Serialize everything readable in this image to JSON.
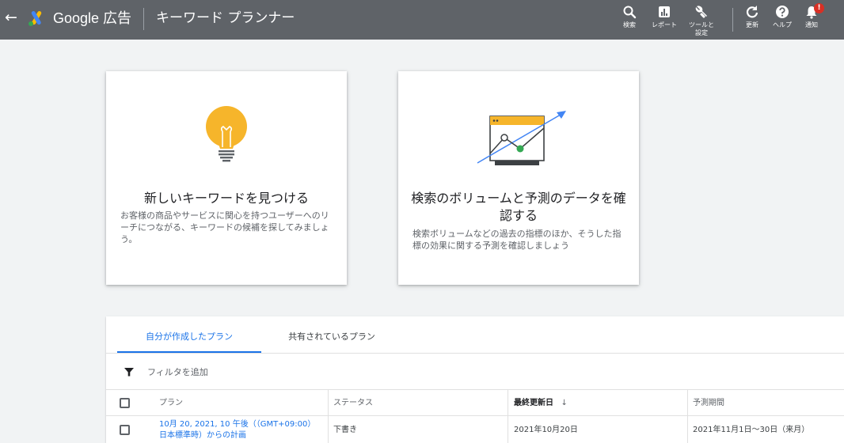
{
  "topbar": {
    "back_glyph": "←",
    "brand": "Google 広告",
    "app_title": "キーワード プランナー",
    "tools": [
      {
        "icon": "search-icon",
        "label": "検索"
      },
      {
        "icon": "reports-icon",
        "label": "レポート"
      },
      {
        "icon": "wrench-icon",
        "label": "ツールと\n設定"
      },
      {
        "icon": "refresh-icon",
        "label": "更新"
      },
      {
        "icon": "help-icon",
        "label": "ヘルプ"
      },
      {
        "icon": "bell-icon",
        "label": "通知"
      }
    ],
    "notification_badge": "!"
  },
  "cards": [
    {
      "title": "新しいキーワードを見つける",
      "description": "お客様の商品やサービスに関心を持つユーザーへのリーチにつながる、キーワードの候補を探してみましょう。"
    },
    {
      "title": "検索のボリュームと予測のデータを確認する",
      "description": "検索ボリュームなどの過去の指標のほか、そうした指標の効果に関する予測を確認しましょう"
    }
  ],
  "plans": {
    "tabs": [
      {
        "label": "自分が作成したプラン",
        "active": true
      },
      {
        "label": "共有されているプラン",
        "active": false
      }
    ],
    "filter_label": "フィルタを追加",
    "columns": {
      "plan": "プラン",
      "status": "ステータス",
      "last_updated": "最終更新日",
      "sort_glyph": "↓",
      "forecast_period": "予測期間"
    },
    "rows": [
      {
        "plan": "10月 20, 2021, 10 午後（（GMT+09:00）日本標準時）からの計画",
        "status": "下書き",
        "last_updated": "2021年10月20日",
        "forecast_period": "2021年11月1日～30日（来月）"
      }
    ]
  },
  "colors": {
    "topbar": "#5f6368",
    "accent": "#1a73e8",
    "bulb": "#f6b52b",
    "chart_green": "#34a853",
    "notification": "#d93025"
  }
}
